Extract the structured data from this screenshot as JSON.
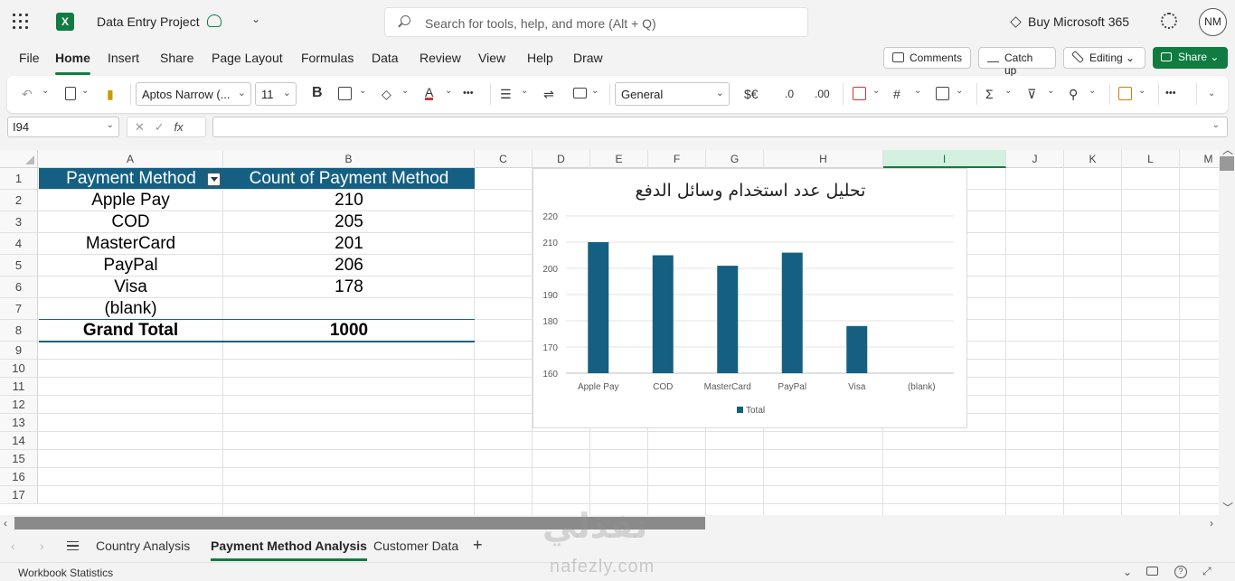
{
  "titlebar": {
    "doc_title": "Data Entry Project",
    "search_placeholder": "Search for tools, help, and more (Alt + Q)",
    "buy_label": "Buy Microsoft 365",
    "avatar_initials": "NM"
  },
  "ribbon": {
    "tabs": [
      "File",
      "Home",
      "Insert",
      "Share",
      "Page Layout",
      "Formulas",
      "Data",
      "Review",
      "View",
      "Help",
      "Draw"
    ],
    "active_tab": "Home",
    "comments_label": "Comments",
    "catchup_label": "Catch up",
    "editing_label": "Editing",
    "share_label": "Share"
  },
  "toolbar": {
    "font_name": "Aptos Narrow (...",
    "font_size": "11",
    "bold_label": "B",
    "number_format": "General",
    "currency_label": "$€",
    "more_label": "•••"
  },
  "formula_bar": {
    "name_box": "I94",
    "fx_label": "fx",
    "formula": ""
  },
  "grid": {
    "columns": [
      "A",
      "B",
      "C",
      "D",
      "E",
      "F",
      "G",
      "H",
      "I",
      "J",
      "K",
      "L",
      "M"
    ],
    "selected_column": "I",
    "rows": [
      "1",
      "2",
      "3",
      "4",
      "5",
      "6",
      "7",
      "8",
      "9",
      "10",
      "11",
      "12",
      "13",
      "14",
      "15",
      "16",
      "17"
    ],
    "pivot": {
      "header": [
        "Payment Method",
        "Count of Payment Method"
      ],
      "rows": [
        [
          "Apple Pay",
          "210"
        ],
        [
          "COD",
          "205"
        ],
        [
          "MasterCard",
          "201"
        ],
        [
          "PayPal",
          "206"
        ],
        [
          "Visa",
          "178"
        ],
        [
          "(blank)",
          ""
        ]
      ],
      "total": [
        "Grand Total",
        "1000"
      ]
    }
  },
  "chart_data": {
    "type": "bar",
    "title": "تحليل عدد استخدام وسائل الدفع",
    "categories": [
      "Apple Pay",
      "COD",
      "MasterCard",
      "PayPal",
      "Visa",
      "(blank)"
    ],
    "series": [
      {
        "name": "Total",
        "values": [
          210,
          205,
          201,
          206,
          178,
          null
        ],
        "color": "#156082"
      }
    ],
    "ylim": [
      160,
      220
    ],
    "yticks": [
      "160",
      "170",
      "180",
      "190",
      "200",
      "210",
      "220"
    ],
    "grid": true,
    "legend": "bottom"
  },
  "sheets": {
    "tabs": [
      "Country Analysis",
      "Payment Method Analysis",
      "Customer Data"
    ],
    "active": "Payment Method Analysis",
    "add_label": "+"
  },
  "status": {
    "workbook_stats": "Workbook Statistics"
  },
  "watermark": {
    "arabic": "نفذلي",
    "latin": "nafezly.com"
  },
  "colors": {
    "accent": "#107c41",
    "pivot_header": "#156082",
    "bar": "#156082"
  }
}
